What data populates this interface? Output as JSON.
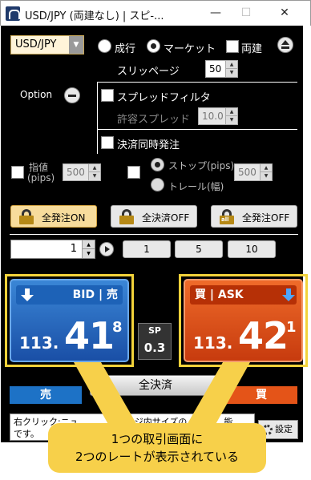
{
  "window": {
    "title": "USD/JPY (両建なし) | スピ-...",
    "minimize_icon": "minimize-icon",
    "maximize_icon": "maximize-icon",
    "close_icon": "close-icon"
  },
  "pair": {
    "selected": "USD/JPY"
  },
  "order_type": {
    "market_label": "成行",
    "marketable_label": "マーケット",
    "selected": "マーケット",
    "both_label": "両建"
  },
  "slippage": {
    "label": "スリッページ",
    "value": "50"
  },
  "option": {
    "label": "Option"
  },
  "spread_filter": {
    "label": "スプレッドフィルタ",
    "tolerance_label": "許容スプレッド",
    "tolerance_value": "10.0"
  },
  "simultaneous": {
    "label": "決済同時発注"
  },
  "limit": {
    "label_line1": "指値",
    "label_line2": "(pips)",
    "value": "500"
  },
  "stop": {
    "stop_label": "ストップ(pips)",
    "trail_label": "トレール(幅)",
    "selected": "ストップ(pips)",
    "value": "500"
  },
  "order_buttons": {
    "all_order_on": "全発注ON",
    "close_all_off": "全決済OFF",
    "all_order_off": "全発注OFF",
    "all_badge": "all"
  },
  "quantity": {
    "value": "1",
    "presets": [
      "1",
      "5",
      "10"
    ]
  },
  "bid": {
    "label": "BID | 売",
    "rate_prefix": "113.",
    "rate_big": "41",
    "rate_pip": "8"
  },
  "ask": {
    "label": "買 | ASK",
    "rate_prefix": "113.",
    "rate_big": "42",
    "rate_pip": "1"
  },
  "spread": {
    "label": "SP",
    "value": "0.3"
  },
  "sell_label": "売",
  "buy_label": "買",
  "close_all_label": "全決済",
  "note": {
    "line1": "右クリック:ニュ",
    "line1_end": "ジ内サイズの",
    "line1_tail": "能",
    "line2": "です。"
  },
  "settings_label": "設定",
  "callout": {
    "line1": "1つの取引画面に",
    "line2": "2つのレートが表示されている"
  },
  "colors": {
    "bid_blue": "#1a4fa6",
    "ask_orange": "#c73b0e",
    "highlight_yellow": "#f2d23a",
    "panel_bg": "#000000"
  }
}
